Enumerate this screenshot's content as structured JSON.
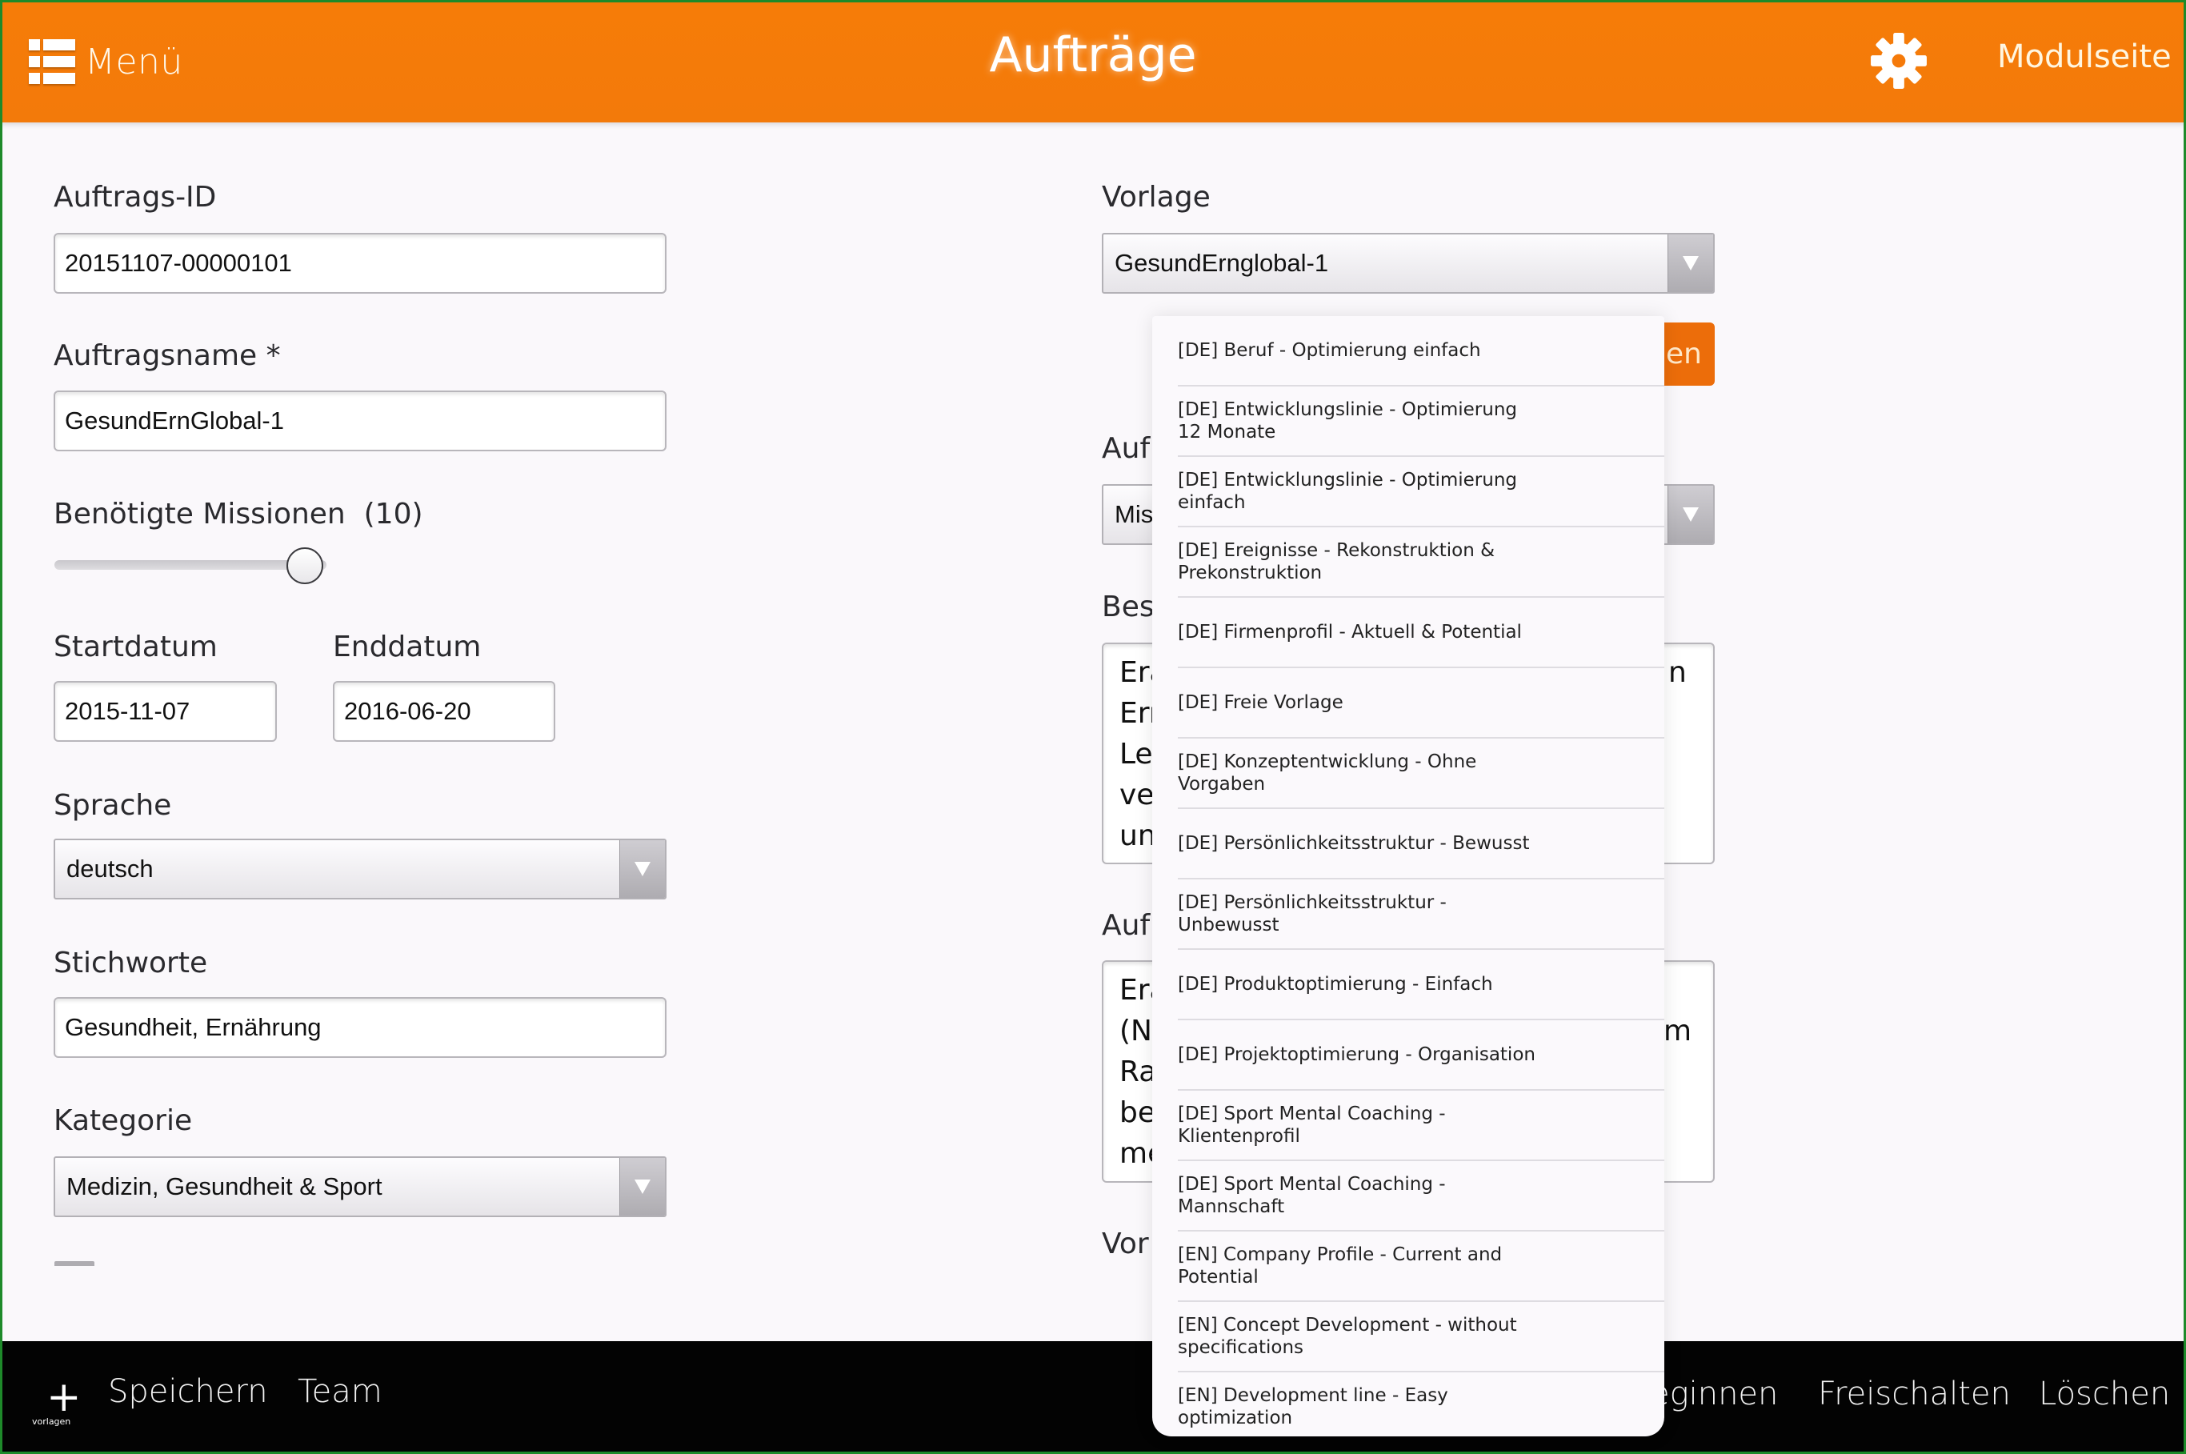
{
  "header": {
    "menu_label": "Menü",
    "title": "Aufträge",
    "settings_icon": "gear-icon",
    "module_link": "Modulseite",
    "accent_color": "#f57a0a"
  },
  "left": {
    "order_id": {
      "label": "Auftrags-ID",
      "value": "20151107-00000101"
    },
    "order_name": {
      "label": "Auftragsname *",
      "value": "GesundErnGlobal-1"
    },
    "missions": {
      "label": "Benötigte Missionen",
      "count_text": "(10)",
      "value": 10,
      "fraction": 0.92
    },
    "start_date": {
      "label": "Startdatum",
      "value": "2015-11-07"
    },
    "end_date": {
      "label": "Enddatum",
      "value": "2016-06-20"
    },
    "language": {
      "label": "Sprache",
      "value": "deutsch"
    },
    "keywords": {
      "label": "Stichworte",
      "value": "Gesundheit, Ernährung"
    },
    "category": {
      "label": "Kategorie",
      "value": "Medizin, Gesundheit & Sport"
    }
  },
  "right": {
    "template": {
      "label": "Vorlage",
      "value": "GesundErnglobal-1"
    },
    "apply_button_partial": "gen",
    "order_type": {
      "label_partial": "Auf",
      "value_partial": "Mis"
    },
    "description": {
      "label_partial": "Bes",
      "lines_left": [
        "Era",
        "Ern",
        "Le",
        "ve",
        "un"
      ],
      "lines_right": [
        "n",
        "",
        "",
        "",
        ""
      ]
    },
    "task": {
      "label_partial": "Auf",
      "lines_left": [
        "Era",
        "(N",
        "Ra",
        "be",
        "me"
      ],
      "lines_right": [
        "",
        "m",
        "",
        "",
        ""
      ]
    },
    "footer_label_partial": "Vor"
  },
  "dropdown": {
    "options": [
      "[DE] Beruf - Optimierung einfach",
      "[DE] Entwicklungslinie - Optimierung 12 Monate",
      "[DE] Entwicklungslinie - Optimierung einfach",
      "[DE] Ereignisse - Rekonstruktion & Prekonstruktion",
      "[DE] Firmenprofil - Aktuell & Potential",
      "[DE] Freie Vorlage",
      "[DE] Konzeptentwicklung - Ohne Vorgaben",
      "[DE] Persönlichkeitsstruktur - Bewusst",
      "[DE] Persönlichkeitsstruktur - Unbewusst",
      "[DE] Produktoptimierung - Einfach",
      "[DE] Projektoptimierung - Organisation",
      "[DE] Sport Mental Coaching - Klientenprofil",
      "[DE] Sport Mental Coaching - Mannschaft",
      "[EN] Company Profile - Current and Potential",
      "[EN] Concept Development - without specifications",
      "[EN] Development line - Easy optimization"
    ]
  },
  "footer": {
    "add_label": "+",
    "add_sublabel": "vorlagen",
    "save": "Speichern",
    "team": "Team",
    "begin_partial": "eginnen",
    "unlock": "Freischalten",
    "delete": "Löschen"
  }
}
